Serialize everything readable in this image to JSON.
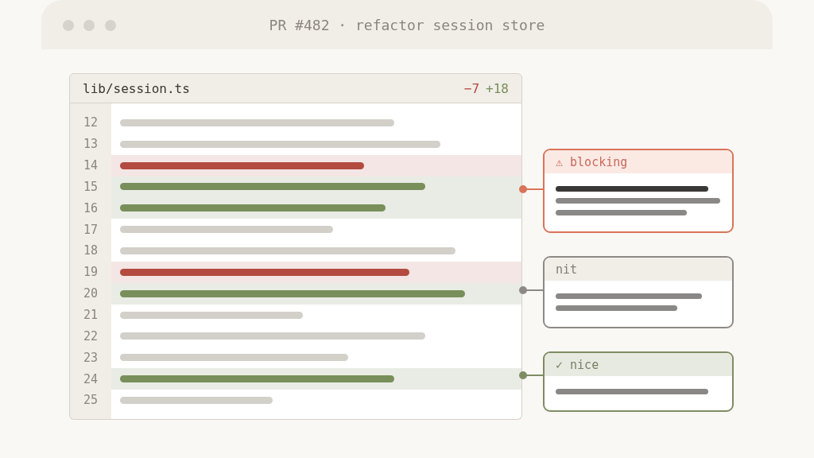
{
  "window": {
    "title": "PR #482 · refactor session store"
  },
  "file": {
    "name": "lib/session.ts",
    "deletions": "−7",
    "additions": "+18"
  },
  "lines": [
    {
      "number": "12",
      "kind": "context"
    },
    {
      "number": "13",
      "kind": "context"
    },
    {
      "number": "14",
      "kind": "removed"
    },
    {
      "number": "15",
      "kind": "added"
    },
    {
      "number": "16",
      "kind": "added"
    },
    {
      "number": "17",
      "kind": "context"
    },
    {
      "number": "18",
      "kind": "context"
    },
    {
      "number": "19",
      "kind": "removed"
    },
    {
      "number": "20",
      "kind": "added"
    },
    {
      "number": "21",
      "kind": "context"
    },
    {
      "number": "22",
      "kind": "context"
    },
    {
      "number": "23",
      "kind": "context"
    },
    {
      "number": "24",
      "kind": "added"
    },
    {
      "number": "25",
      "kind": "context"
    }
  ],
  "comments": [
    {
      "kind": "blocking",
      "label": "⚠ blocking"
    },
    {
      "kind": "nit",
      "label": "nit"
    },
    {
      "kind": "nice",
      "label": "✓ nice"
    }
  ]
}
